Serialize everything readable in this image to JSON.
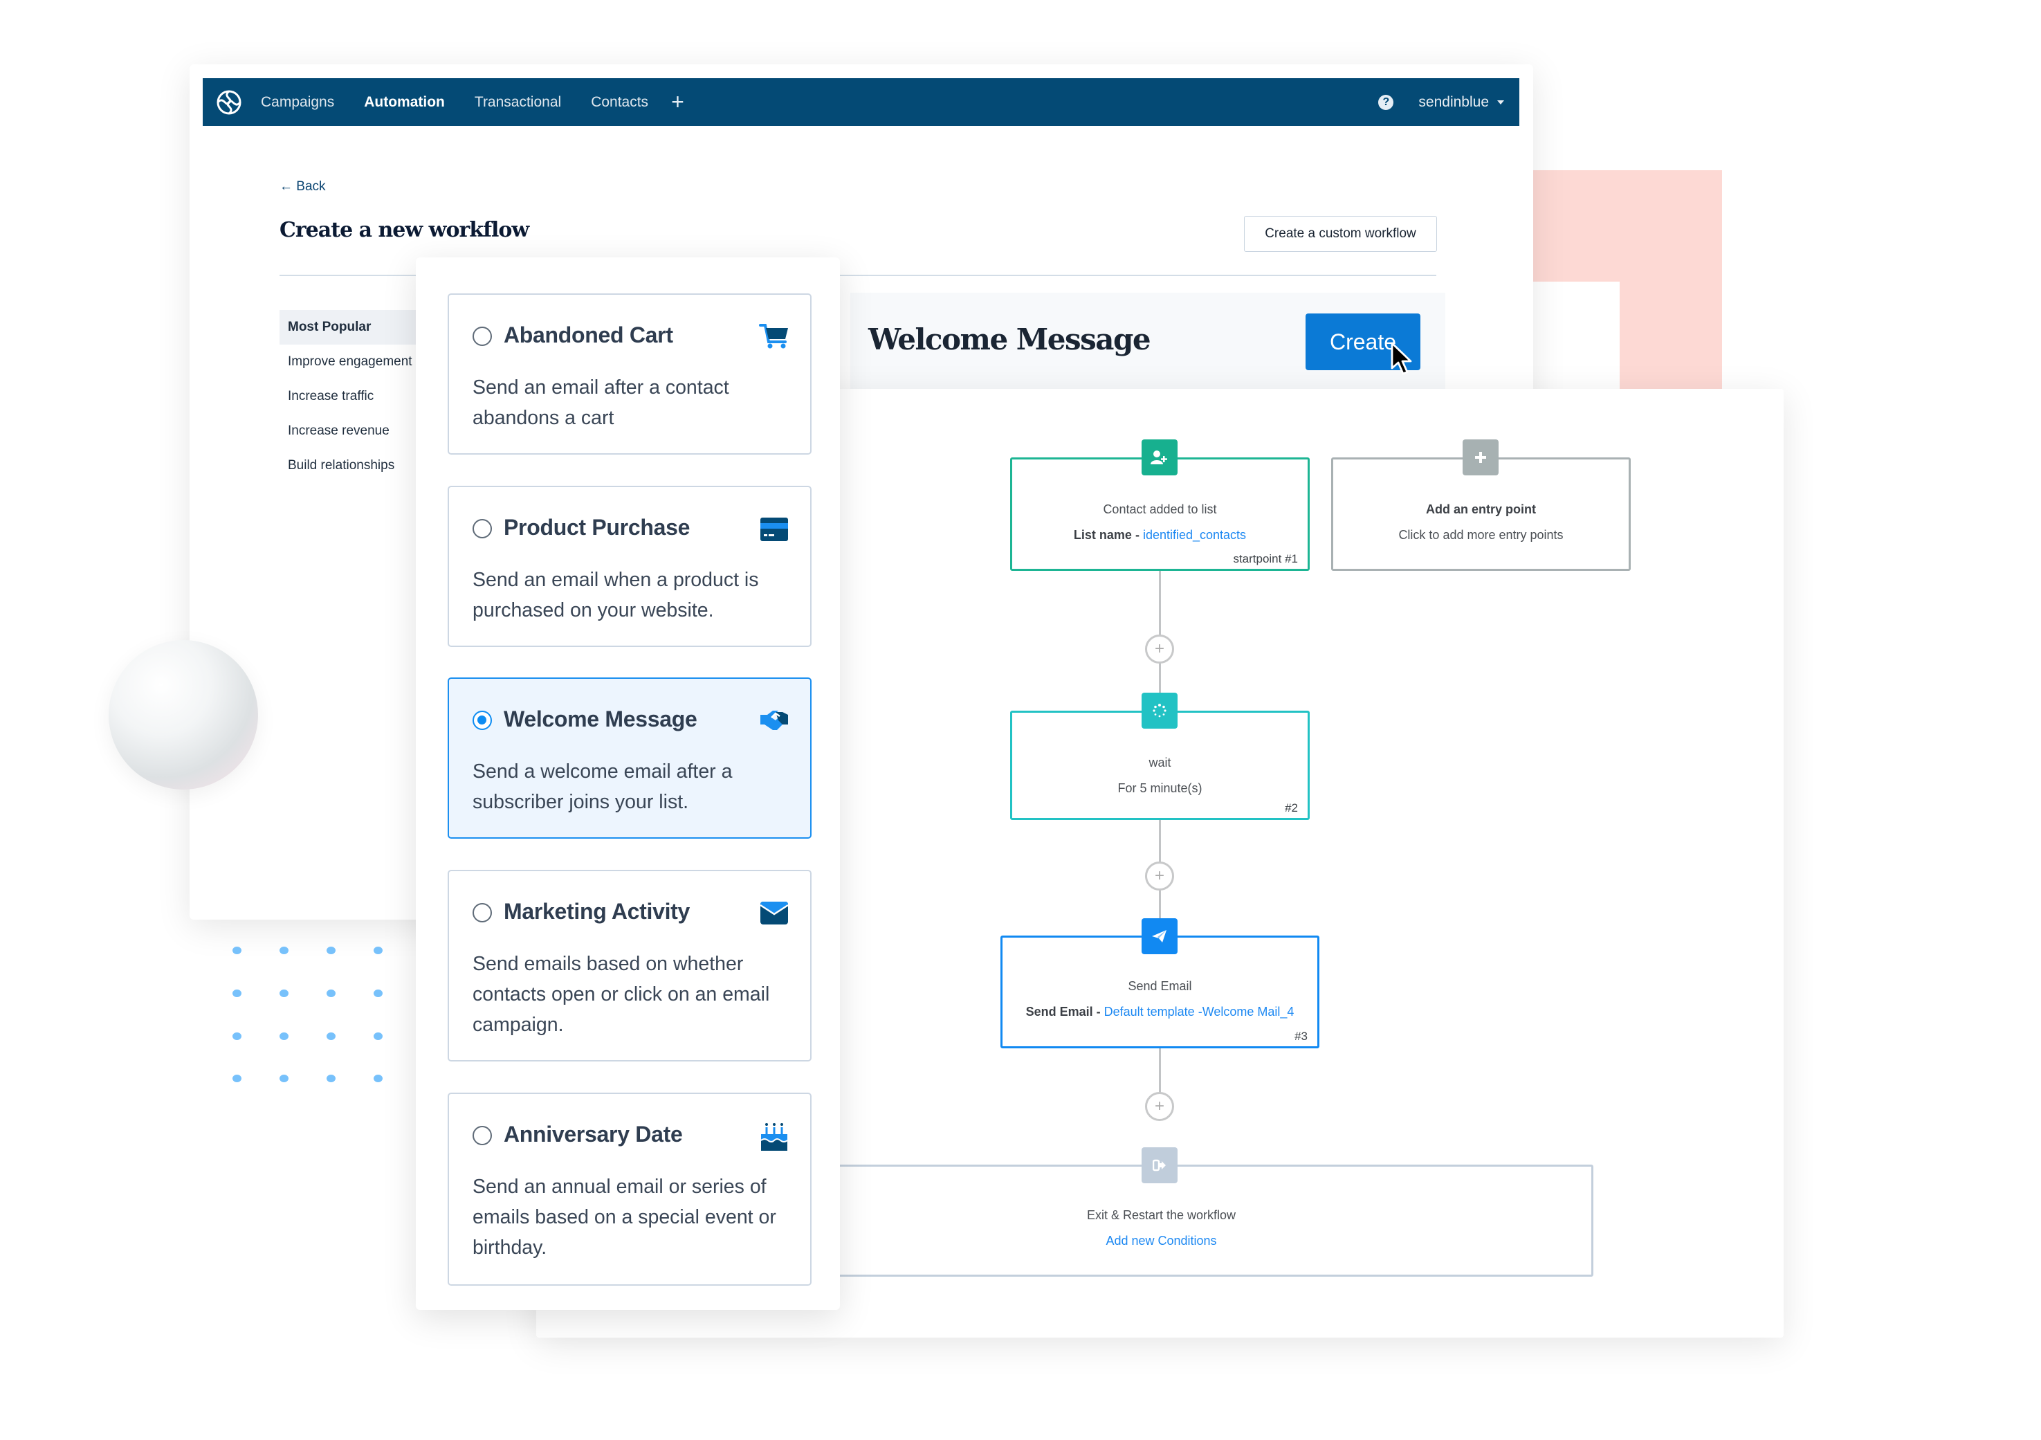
{
  "nav": {
    "items": [
      {
        "label": "Campaigns",
        "active": false
      },
      {
        "label": "Automation",
        "active": true
      },
      {
        "label": "Transactional",
        "active": false
      },
      {
        "label": "Contacts",
        "active": false
      }
    ],
    "plus_label": "+",
    "help_label": "?",
    "account_label": "sendinblue"
  },
  "page": {
    "back_label": "← Back",
    "title": "Create a new workflow",
    "custom_button": "Create a custom workflow"
  },
  "sidebar": {
    "items": [
      {
        "label": "Most Popular",
        "active": true
      },
      {
        "label": "Improve engagement",
        "active": false
      },
      {
        "label": "Increase traffic",
        "active": false
      },
      {
        "label": "Increase revenue",
        "active": false
      },
      {
        "label": "Build relationships",
        "active": false
      }
    ]
  },
  "preview": {
    "title": "Welcome Message",
    "create_button": "Create"
  },
  "cards": [
    {
      "title": "Abandoned Cart",
      "description": "Send an email after a contact abandons a cart",
      "icon": "shopping-cart-icon",
      "selected": false
    },
    {
      "title": "Product Purchase",
      "description": "Send an email when a product is purchased on your website.",
      "icon": "credit-card-icon",
      "selected": false
    },
    {
      "title": "Welcome Message",
      "description": "Send a welcome email after a subscriber joins your list.",
      "icon": "handshake-icon",
      "selected": true
    },
    {
      "title": "Marketing Activity",
      "description": "Send emails based on whether contacts open or click on an email campaign.",
      "icon": "envelope-icon",
      "selected": false
    },
    {
      "title": "Anniversary Date",
      "description": "Send an annual email or series of emails based on a special event or birthday.",
      "icon": "birthday-cake-icon",
      "selected": false
    }
  ],
  "workflow": {
    "entry": {
      "title": "Contact added to list",
      "label": "List name - ",
      "value": "identified_contacts",
      "tag": "startpoint #1",
      "icon": "user-add-icon",
      "color": "#17b08f"
    },
    "add_entry": {
      "title": "Add an entry point",
      "subtitle": "Click to add more entry points",
      "icon": "plus-icon",
      "color": "#a7b1b2"
    },
    "wait": {
      "title": "wait",
      "subtitle": "For 5 minute(s)",
      "tag": "#2",
      "icon": "spinner-icon",
      "color": "#22c2c4"
    },
    "send_email": {
      "title": "Send Email",
      "label": "Send Email - ",
      "value": "Default template -Welcome Mail_4",
      "tag": "#3",
      "icon": "paper-plane-icon",
      "color": "#1189f2"
    },
    "exit": {
      "title": "Exit & Restart the workflow",
      "link": "Add new Conditions",
      "icon": "exit-icon",
      "color": "#c0cddb"
    },
    "add_step_label": "+"
  },
  "colors": {
    "nav_bg": "#044a75",
    "primary": "#0b7ad6",
    "link": "#1c88f2",
    "accent_pink": "#fdd9d4",
    "dots": "#77c1fb"
  }
}
